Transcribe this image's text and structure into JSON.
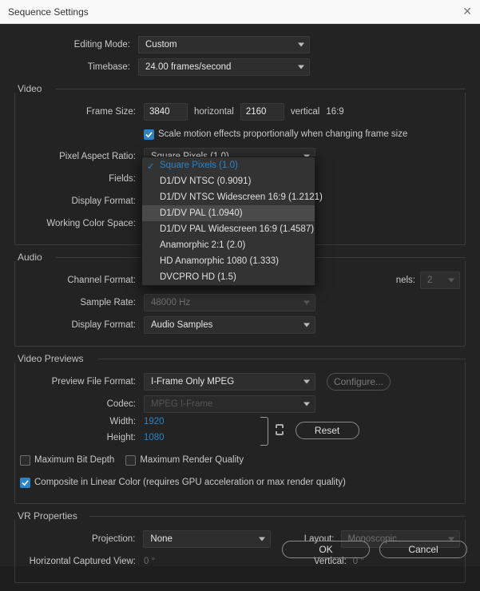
{
  "window": {
    "title": "Sequence Settings"
  },
  "general": {
    "editing_mode_label": "Editing Mode:",
    "editing_mode_value": "Custom",
    "timebase_label": "Timebase:",
    "timebase_value": "24.00  frames/second"
  },
  "video": {
    "heading": "Video",
    "frame_size_label": "Frame Size:",
    "width": "3840",
    "horizontal": "horizontal",
    "height": "2160",
    "vertical": "vertical",
    "aspect": "16:9",
    "scale_checkbox": "Scale motion effects proportionally when changing frame size",
    "scale_checked": true,
    "pixel_aspect_label": "Pixel Aspect Ratio:",
    "pixel_aspect_value": "Square Pixels (1.0)",
    "pixel_aspect_options": [
      "Square Pixels (1.0)",
      "D1/DV NTSC (0.9091)",
      "D1/DV NTSC Widescreen 16:9 (1.2121)",
      "D1/DV PAL (1.0940)",
      "D1/DV PAL Widescreen 16:9 (1.4587)",
      "Anamorphic 2:1 (2.0)",
      "HD Anamorphic 1080 (1.333)",
      "DVCPRO HD (1.5)"
    ],
    "fields_label": "Fields:",
    "display_format_label": "Display Format:",
    "working_color_space_label": "Working Color Space:"
  },
  "audio": {
    "heading": "Audio",
    "channel_format_label": "Channel Format:",
    "channels_label": "nels:",
    "channels_value": "2",
    "sample_rate_label": "Sample Rate:",
    "sample_rate_value": "48000 Hz",
    "display_format_label": "Display Format:",
    "display_format_value": "Audio Samples"
  },
  "previews": {
    "heading": "Video Previews",
    "preview_file_format_label": "Preview File Format:",
    "preview_file_format_value": "I-Frame Only MPEG",
    "configure_label": "Configure...",
    "codec_label": "Codec:",
    "codec_value": "MPEG I-Frame",
    "width_label": "Width:",
    "width_value": "1920",
    "height_label": "Height:",
    "height_value": "1080",
    "reset_label": "Reset",
    "max_bit_depth": "Maximum Bit Depth",
    "max_bit_depth_checked": false,
    "max_render_quality": "Maximum Render Quality",
    "max_render_quality_checked": false,
    "composite_linear": "Composite in Linear Color (requires GPU acceleration or max render quality)",
    "composite_linear_checked": true
  },
  "vr": {
    "heading": "VR Properties",
    "projection_label": "Projection:",
    "projection_value": "None",
    "layout_label": "Layout:",
    "layout_value": "Monoscopic",
    "hcv_label": "Horizontal Captured View:",
    "hcv_value": "0 °",
    "vertical_label": "Vertical:",
    "vertical_value": "0 °"
  },
  "footer": {
    "ok": "OK",
    "cancel": "Cancel"
  }
}
